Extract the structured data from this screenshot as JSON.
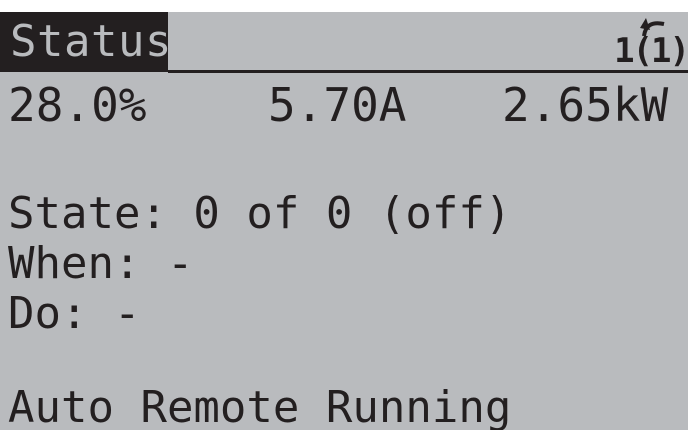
{
  "header": {
    "title": "Status",
    "setup_indicator": "1(1)",
    "setup_icon": "curved-arrow-icon"
  },
  "readouts": {
    "reference": "28.0%",
    "current": "5.70A",
    "power": "2.65kW"
  },
  "details": {
    "state": "State: 0 of 0 (off)",
    "when": "When: -",
    "do": "Do: -"
  },
  "status_line": "Auto Remote Running",
  "colors": {
    "background": "#b9bbbe",
    "foreground": "#231f20"
  }
}
